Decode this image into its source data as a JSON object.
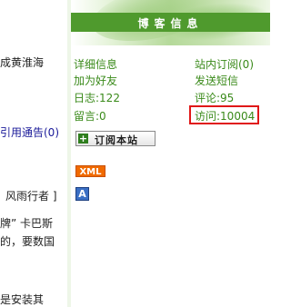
{
  "left_content": {
    "line1": "成黄淮海",
    "line2": "引用通告(0)",
    "line3": "风雨行者 ]",
    "line4": "牌” 卡巴斯",
    "line5": "的，要数国",
    "line6": "是安装其"
  },
  "sidebar": {
    "title": "博客信息",
    "links": {
      "details": "详细信息",
      "inbox": "站内订阅(0)",
      "add_friend": "加为好友",
      "send_message": "发送短信"
    },
    "stats": {
      "logs": "日志:122",
      "comments": "评论:95",
      "messages": "留言:0",
      "visits": "访问:10004"
    },
    "subscribe_label": "订阅本站",
    "xml_badge": "XML",
    "a_badge": "A"
  },
  "colors": {
    "title_band": "#4f9a2d",
    "link_green": "#3a8a1a",
    "highlight_red": "#e01818",
    "xml_orange": "#f06a00"
  }
}
